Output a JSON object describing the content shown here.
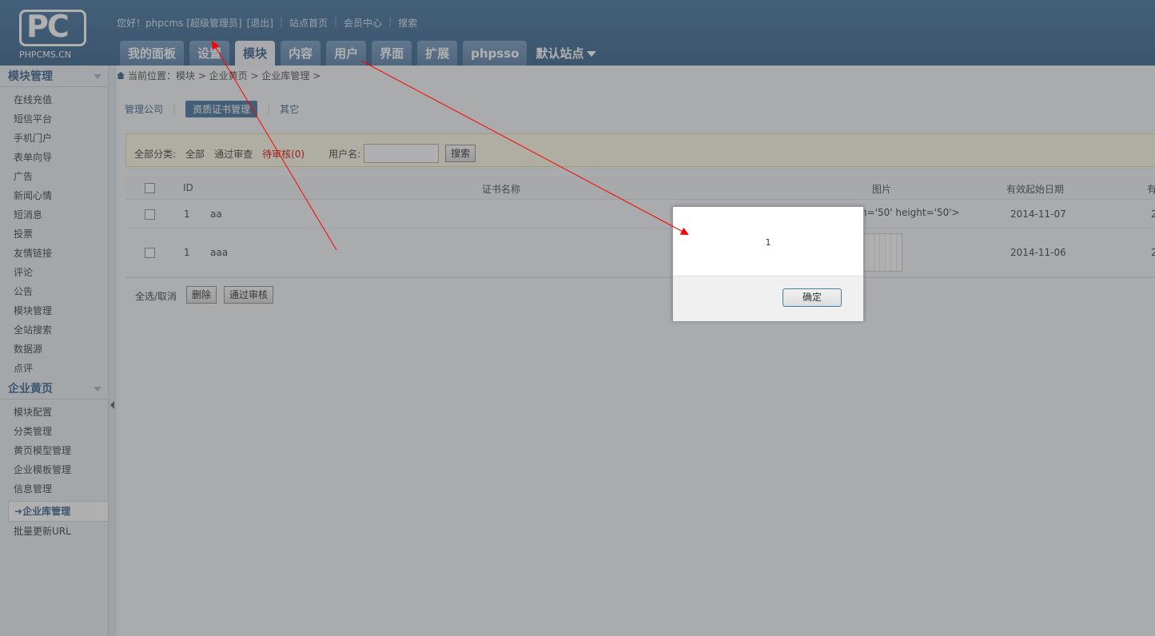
{
  "header": {
    "logo_mark": "PC",
    "logo_text": "PHPCMS.CN",
    "greeting": "您好！phpcms [超级管理员]",
    "logout": "[退出]",
    "site_home": "站点首页",
    "member_center": "会员中心",
    "search": "搜索",
    "tabs": [
      "我的面板",
      "设置",
      "模块",
      "内容",
      "用户",
      "界面",
      "扩展",
      "phpsso"
    ],
    "site_switch": "默认站点"
  },
  "sidebar": {
    "section1_title": "模块管理",
    "section1_items": [
      "在线充值",
      "短信平台",
      "手机门户",
      "表单向导",
      "广告",
      "新闻心情",
      "短消息",
      "投票",
      "友情链接",
      "评论",
      "公告",
      "模块管理",
      "全站搜索",
      "数据源",
      "点评"
    ],
    "section2_title": "企业黄页",
    "section2_items": [
      "模块配置",
      "分类管理",
      "黄页模型管理",
      "企业模板管理",
      "信息管理"
    ],
    "active_item": "企业库管理",
    "last_item": "批量更新URL"
  },
  "breadcrumb": "当前位置：模块 > 企业黄页 > 企业库管理 >",
  "subnav": {
    "item1": "管理公司",
    "item2": "资质证书管理",
    "item3": "其它"
  },
  "filter": {
    "category_label": "全部分类:",
    "all": "全部",
    "approved": "通过审查",
    "pending": "待审核(0)",
    "username_label": "用户名:",
    "username_value": "",
    "search_button": "搜索"
  },
  "table": {
    "headers": {
      "id": "ID",
      "name": "证书名称",
      "image": "图片",
      "start_date": "有效起始日期",
      "end_date": "有"
    },
    "rows": [
      {
        "id": "1",
        "name": "aa",
        "image_text": "h='50' height='50'>",
        "start_date": "2014-11-07",
        "end_date": "2"
      },
      {
        "id": "1",
        "name": "aaa",
        "image_text": "",
        "start_date": "2014-11-06",
        "end_date": "2"
      }
    ]
  },
  "footer": {
    "select_all": "全选/取消",
    "delete": "删除",
    "approve": "通过审核"
  },
  "dialog": {
    "message": "1",
    "ok": "确定"
  },
  "colors": {
    "header": "#3a6c9a",
    "accent": "#2c5a86",
    "pending": "#cc0000",
    "arrow": "#ff0000"
  }
}
